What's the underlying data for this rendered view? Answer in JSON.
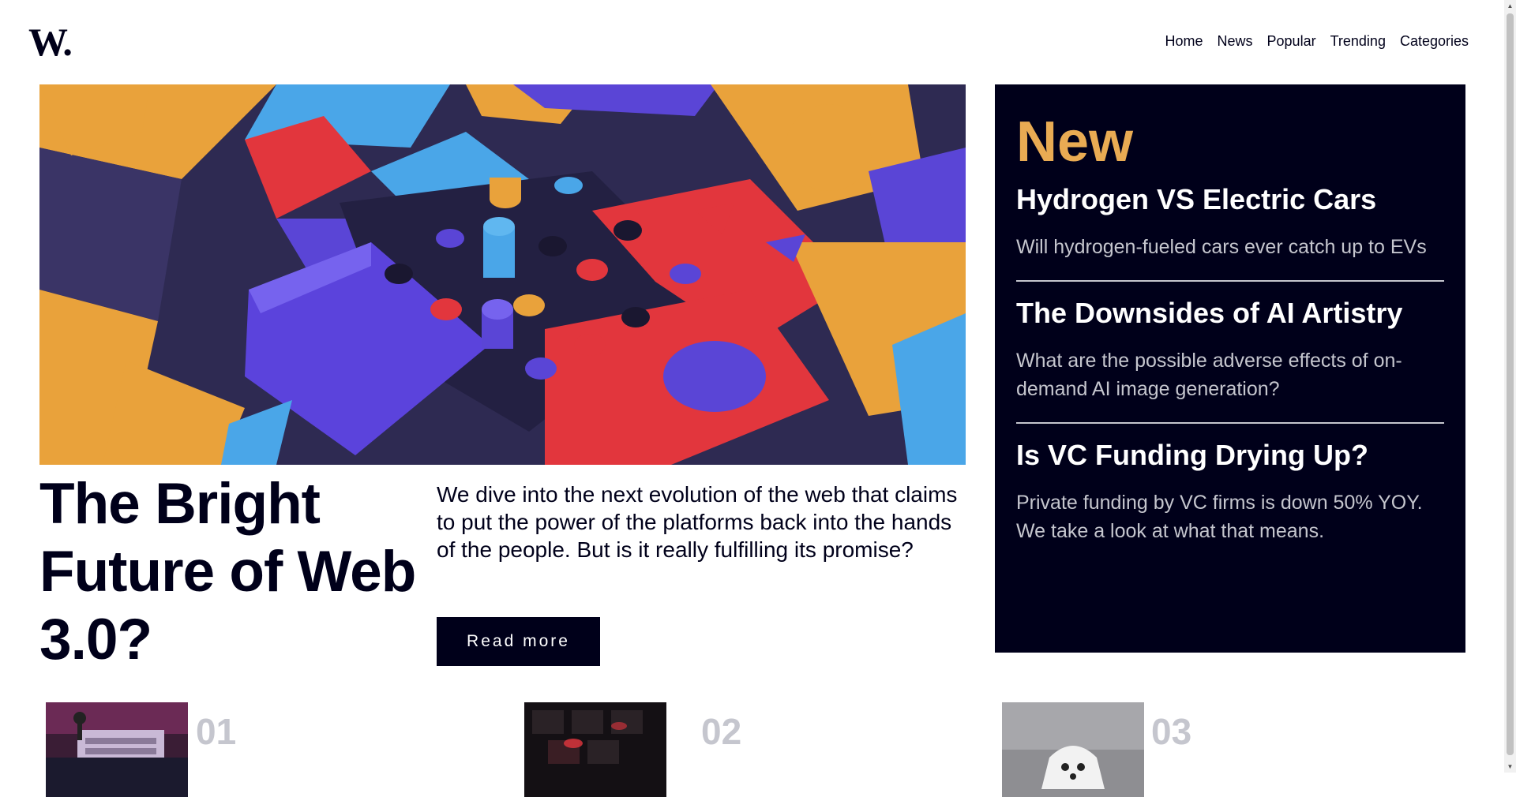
{
  "logo": {
    "text": "W."
  },
  "nav": {
    "items": [
      "Home",
      "News",
      "Popular",
      "Trending",
      "Categories"
    ]
  },
  "hero": {
    "title": "The Bright Future of Web 3.0?",
    "description": "We dive into the next evolution of the web that claims to put the power of the platforms back into the hands of the people. But is it really fulfilling its promise?",
    "read_more_label": "Read more"
  },
  "new_panel": {
    "heading": "New",
    "items": [
      {
        "title": "Hydrogen VS Electric Cars",
        "summary": "Will hydrogen-fueled cars ever catch up to EVs"
      },
      {
        "title": "The Downsides of AI Artistry",
        "summary": "What are the possible adverse effects of on-demand AI image generation?"
      },
      {
        "title": "Is VC Funding Drying Up?",
        "summary": "Private funding by VC firms is down 50% YOY. We take a look at what that means."
      }
    ]
  },
  "cards": [
    {
      "number": "01"
    },
    {
      "number": "02"
    },
    {
      "number": "03"
    }
  ],
  "colors": {
    "dark": "#00001a",
    "accent": "#e9ab53",
    "muted": "#c5c6ce",
    "white": "#ffffff"
  }
}
